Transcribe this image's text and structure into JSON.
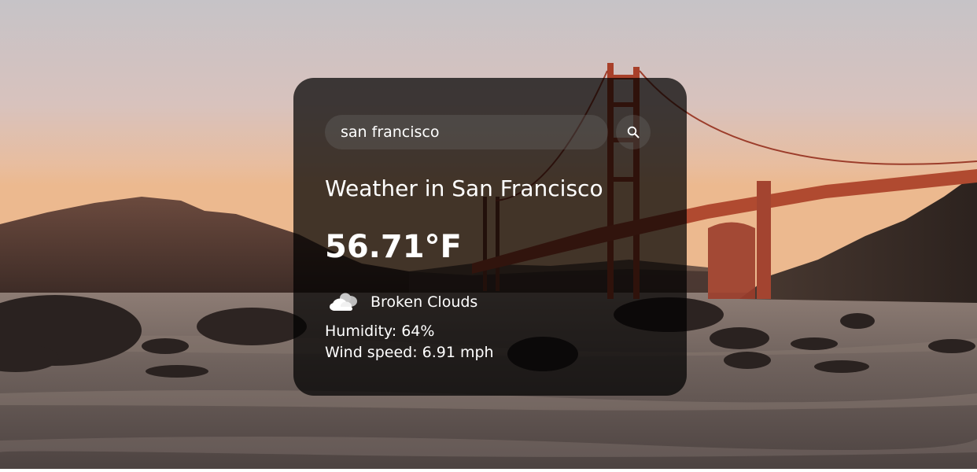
{
  "search": {
    "value": "san francisco",
    "placeholder": "Search"
  },
  "weather": {
    "title": "Weather in San Francisco",
    "temperature": "56.71°F",
    "description": "Broken Clouds",
    "humidity_label": "Humidity: 64%",
    "wind_label": "Wind speed: 6.91 mph",
    "icon": "broken-clouds-icon"
  },
  "background": {
    "scene": "golden-gate-bridge-sunset",
    "colors": {
      "sky_top": "#c9c4c6",
      "sky_horizon": "#e7b392",
      "bridge": "#b8452c",
      "water": "#6e625e"
    }
  },
  "card": {
    "background": "rgba(0,0,0,0.72)",
    "text_color": "#ffffff"
  }
}
